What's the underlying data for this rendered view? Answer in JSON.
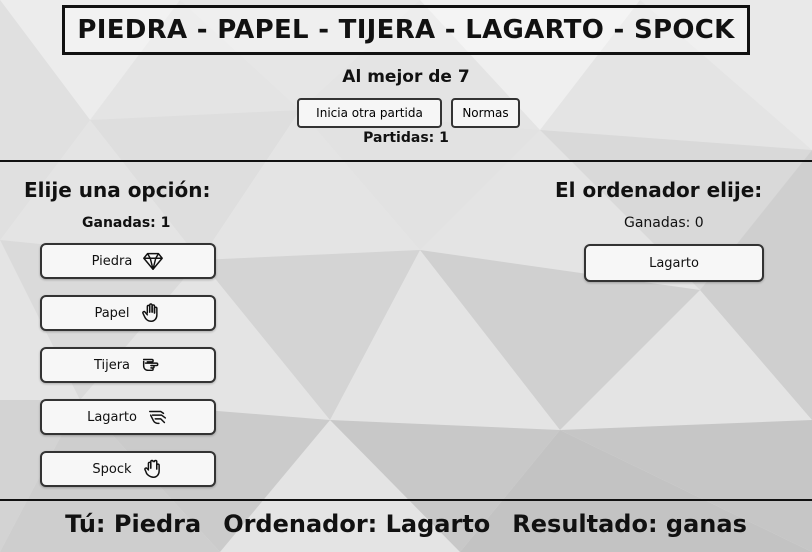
{
  "header": {
    "title": "PIEDRA - PAPEL - TIJERA - LAGARTO - SPOCK",
    "subtitle": "Al mejor de 7",
    "new_game_label": "Inicia otra partida",
    "rules_label": "Normas",
    "games_count": "Partidas: 1"
  },
  "player": {
    "heading": "Elije una opción:",
    "wins": "Ganadas: 1",
    "options": [
      {
        "label": "Piedra",
        "icon": "diamond-icon"
      },
      {
        "label": "Papel",
        "icon": "open-hand-icon"
      },
      {
        "label": "Tijera",
        "icon": "scissors-hand-icon"
      },
      {
        "label": "Lagarto",
        "icon": "lizard-hand-icon"
      },
      {
        "label": "Spock",
        "icon": "vulcan-salute-icon"
      }
    ]
  },
  "computer": {
    "heading": "El ordenador elije:",
    "wins": "Ganadas: 0",
    "choice": "Lagarto"
  },
  "footer": {
    "you": "Tú: Piedra",
    "computer": "Ordenador: Lagarto",
    "result": "Resultado: ganas"
  }
}
